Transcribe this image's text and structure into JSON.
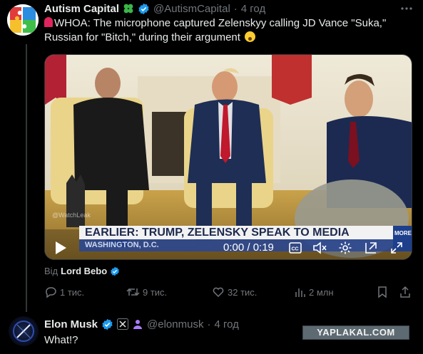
{
  "post": {
    "author_name": "Autism Capital",
    "author_handle": "@AutismCapital",
    "separator": "·",
    "time": "4 год",
    "text": "WHOA: The microphone captured Zelenskyy calling JD Vance \"Suka,\" Russian for \"Bitch,\" during their argument",
    "media": {
      "chyron": "EARLIER: TRUMP, ZELENSKY SPEAK TO MEDIA",
      "location": "WASHINGTON, D.C.",
      "more_badge": "MORE",
      "watermark": "@WatchLeak",
      "time_display": "0:00 / 0:19"
    },
    "from_prefix": "Від",
    "from_name": "Lord Bebo",
    "actions": {
      "replies": "1 тис.",
      "reposts": "9 тис.",
      "likes": "32 тис.",
      "views": "2 млн"
    }
  },
  "reply": {
    "author_name": "Elon Musk",
    "author_handle": "@elonmusk",
    "separator": "·",
    "time": "4 год",
    "text": "What!?"
  },
  "site_watermark": "YAPLAKAL.COM",
  "colors": {
    "background": "#000000",
    "text": "#e7e9ea",
    "muted": "#71767b",
    "verified": "#1d9bf0",
    "verified_gold": "#e2b719",
    "chyron_bg": "#f2f2f2",
    "chyron_text": "#1d2a4d"
  },
  "icons": {
    "more": "more-icon",
    "verified": "verified-badge-icon",
    "clover": "clover-icon",
    "siren": "siren-icon",
    "shocked_face": "shocked-face-icon",
    "play": "play-icon",
    "captions": "captions-icon",
    "mute": "mute-icon",
    "settings": "settings-icon",
    "pip": "pip-icon",
    "fullscreen": "fullscreen-icon",
    "reply": "reply-icon",
    "repost": "repost-icon",
    "like": "like-icon",
    "views": "views-icon",
    "bookmark": "bookmark-icon",
    "share": "share-icon",
    "x_logo": "x-logo-icon",
    "affiliate": "affiliate-icon"
  }
}
